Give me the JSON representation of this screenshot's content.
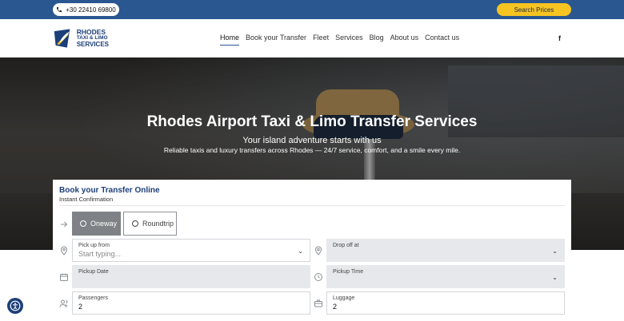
{
  "topbar": {
    "phone": "+30 22410 69800",
    "search_button": "Search Prices"
  },
  "logo": {
    "line1": "RHODES",
    "line2": "TAXI & LIMO",
    "line3": "SERVICES"
  },
  "nav": {
    "items": [
      {
        "label": "Home",
        "active": true
      },
      {
        "label": "Book your Transfer"
      },
      {
        "label": "Fleet"
      },
      {
        "label": "Services"
      },
      {
        "label": "Blog"
      },
      {
        "label": "About us"
      },
      {
        "label": "Contact us"
      }
    ],
    "social": "f"
  },
  "hero": {
    "title": "Rhodes Airport Taxi & Limo Transfer Services",
    "subtitle": "Your island adventure starts with us",
    "description": "Reliable taxis and luxury transfers across Rhodes — 24/7 service, comfort, and a smile every mile."
  },
  "booking": {
    "title": "Book your Transfer Online",
    "subtitle": "Instant Confirmation",
    "trip_types": [
      "Oneway",
      "Roundtrip"
    ],
    "pickup": {
      "label": "Pick up from",
      "placeholder": "Start typing..."
    },
    "dropoff": {
      "label": "Drop off at"
    },
    "pickup_date": {
      "label": "Pickup Date"
    },
    "pickup_time": {
      "label": "Pickup Time"
    },
    "passengers": {
      "label": "Passengers",
      "value": "2"
    },
    "luggage": {
      "label": "Luggage",
      "value": "2"
    }
  },
  "colors": {
    "brand_blue": "#2b5791",
    "accent_yellow": "#f6c421",
    "title_blue": "#1d3f79"
  }
}
